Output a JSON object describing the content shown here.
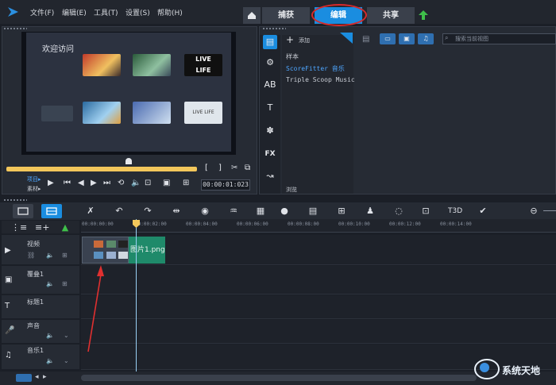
{
  "menu": [
    "文件(F)",
    "编辑(E)",
    "工具(T)",
    "设置(S)",
    "帮助(H)"
  ],
  "modes": {
    "capture": "捕获",
    "edit": "编辑",
    "share": "共享"
  },
  "preview": {
    "welcome_title": "欢迎访问",
    "project_label": "项目▸",
    "clip_label": "素材▸",
    "timecode": "00:00:01:023"
  },
  "library": {
    "add_label": "添加",
    "folders": [
      "样本",
      "ScoreFitter 音乐",
      "Triple Scoop Music"
    ],
    "browse_label": "浏览",
    "search_placeholder": "搜索当前视图"
  },
  "timeline": {
    "ruler_labels": [
      "00:00:00:00",
      "00:00:02:00",
      "00:00:04:00",
      "00:00:06:00",
      "00:00:08:00",
      "00:00:10:00",
      "00:00:12:00",
      "00:00:14:00"
    ],
    "tracks": [
      "视频",
      "覆叠1",
      "标题1",
      "声音",
      "音乐1"
    ],
    "clip_title": "图片1.png"
  },
  "watermark": "系统天地",
  "colors": {
    "accent": "#1a8de0",
    "highlight": "#d82a2a",
    "clip": "#1f8a6a"
  }
}
